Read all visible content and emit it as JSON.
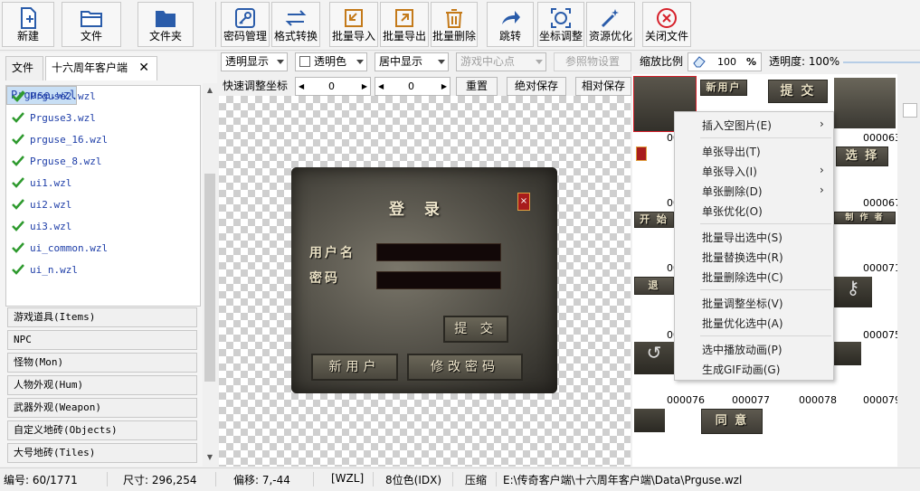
{
  "toolbar": {
    "new": "新建",
    "file": "文件",
    "folder": "文件夹",
    "password_manage": "密码管理",
    "format_convert": "格式转换",
    "batch_import": "批量导入",
    "batch_export": "批量导出",
    "batch_delete": "批量删除",
    "jump": "跳转",
    "coord_adjust": "坐标调整",
    "resource_optimize": "资源优化",
    "close_file": "关闭文件"
  },
  "left_tabs": {
    "file": "文件",
    "client": "十六周年客户端"
  },
  "files": [
    "Prguse.wzl",
    "Prguse2.wzl",
    "Prguse3.wzl",
    "prguse_16.wzl",
    "Prguse_8.wzl",
    "ui1.wzl",
    "ui2.wzl",
    "ui3.wzl",
    "ui_common.wzl",
    "ui_n.wzl"
  ],
  "categories": [
    "游戏道具(Items)",
    "NPC",
    "怪物(Mon)",
    "人物外观(Hum)",
    "武器外观(Weapon)",
    "自定义地砖(Objects)",
    "大号地砖(Tiles)"
  ],
  "options": {
    "transparent_display": "透明显示",
    "transparent_color": "透明色",
    "center_display": "居中显示",
    "game_center_point": "游戏中心点",
    "reference_setting": "参照物设置",
    "zoom_label": "缩放比例",
    "zoom_value": "100",
    "zoom_unit": "%",
    "opacity_label": "透明度: 100%"
  },
  "coords": {
    "label": "快速调整坐标",
    "x": "0",
    "y": "0",
    "reset": "重置",
    "abs_save": "绝对保存",
    "rel_save": "相对保存"
  },
  "dialog": {
    "title": "登 录",
    "username": "用户名",
    "password": "密码",
    "submit": "提 交",
    "new_user": "新用户",
    "change_password": "修改密码"
  },
  "thumbnails": {
    "numbers": [
      "000063",
      "000067",
      "000071",
      "000075",
      "000076",
      "000077",
      "000078",
      "000079"
    ],
    "partial_numbers": [
      "00",
      "00",
      "00",
      "00"
    ],
    "labels": {
      "new_user": "新用户",
      "submit": "提 交",
      "select": "选 择",
      "start": "开 始",
      "make": "制 作 者",
      "exit": "退",
      "agree": "同 意"
    }
  },
  "context_menu": [
    {
      "label": "插入空图片(E)",
      "has_sub": true
    },
    {
      "label": "单张导出(T)",
      "has_sub": false
    },
    {
      "label": "单张导入(I)",
      "has_sub": true
    },
    {
      "label": "单张删除(D)",
      "has_sub": true
    },
    {
      "label": "单张优化(O)",
      "has_sub": false
    },
    {
      "label": "批量导出选中(S)",
      "has_sub": false
    },
    {
      "label": "批量替换选中(R)",
      "has_sub": false
    },
    {
      "label": "批量删除选中(C)",
      "has_sub": false
    },
    {
      "label": "批量调整坐标(V)",
      "has_sub": false
    },
    {
      "label": "批量优化选中(A)",
      "has_sub": false
    },
    {
      "label": "选中播放动画(P)",
      "has_sub": false
    },
    {
      "label": "生成GIF动画(G)",
      "has_sub": false
    }
  ],
  "status": {
    "index": "编号: 60/1771",
    "size": "尺寸: 296,254",
    "offset": "偏移: 7,-44",
    "format": "[WZL]",
    "color_depth": "8位色(IDX)",
    "compress": "压缩",
    "path": "E:\\传奇客户端\\十六周年客户端\\Data\\Prguse.wzl"
  },
  "colors": {
    "accent": "#1e3ea8",
    "selected_row": "#c8dff5",
    "check_green": "#2e9a2e",
    "close_red": "#d6202a"
  }
}
